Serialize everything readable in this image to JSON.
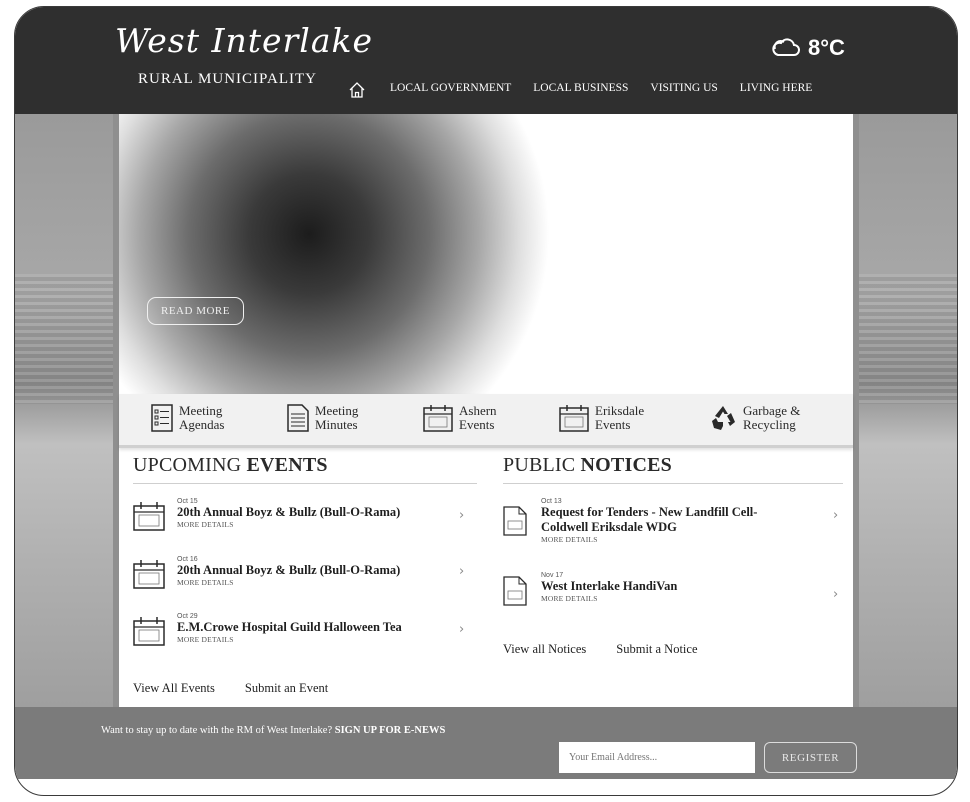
{
  "header": {
    "logo_script": "West Interlake",
    "logo_sub": "RURAL MUNICIPALITY",
    "nav": [
      "LOCAL GOVERNMENT",
      "LOCAL BUSINESS",
      "VISITING US",
      "LIVING HERE"
    ],
    "weather_temp": "8°C"
  },
  "hero": {
    "read_more": "READ MORE"
  },
  "quick_links": [
    {
      "line1": "Meeting",
      "line2": "Agendas",
      "icon": "agenda-list-icon"
    },
    {
      "line1": "Meeting",
      "line2": "Minutes",
      "icon": "document-icon"
    },
    {
      "line1": "Ashern",
      "line2": "Events",
      "icon": "calendar-icon"
    },
    {
      "line1": "Eriksdale",
      "line2": "Events",
      "icon": "calendar-icon"
    },
    {
      "line1": "Garbage &",
      "line2": "Recycling",
      "icon": "recycle-icon"
    }
  ],
  "events": {
    "heading_light": "UPCOMING ",
    "heading_bold": "EVENTS",
    "items": [
      {
        "date": "Oct 15",
        "title": "20th Annual Boyz & Bullz (Bull-O-Rama)",
        "more": "MORE DETAILS"
      },
      {
        "date": "Oct 16",
        "title": "20th Annual Boyz & Bullz (Bull-O-Rama)",
        "more": "MORE DETAILS"
      },
      {
        "date": "Oct 29",
        "title": "E.M.Crowe Hospital Guild Halloween Tea",
        "more": "MORE DETAILS"
      }
    ],
    "view_all": "View All Events",
    "submit": "Submit an Event"
  },
  "notices": {
    "heading_light": "PUBLIC ",
    "heading_bold": "NOTICES",
    "items": [
      {
        "date": "Oct 13",
        "title_line1": "Request for Tenders - New Landfill Cell-",
        "title_line2": "Coldwell Eriksdale WDG",
        "more": "MORE DETAILS"
      },
      {
        "date": "Nov 17",
        "title_line1": "West Interlake HandiVan",
        "title_line2": "",
        "more": "MORE DETAILS"
      }
    ],
    "view_all": "View all Notices",
    "submit": "Submit a Notice"
  },
  "newsletter": {
    "text": "Want to stay up to date with the RM of West Interlake? ",
    "text_bold": "SIGN UP FOR E-NEWS",
    "email_placeholder": "Your Email Address...",
    "register": "REGISTER"
  }
}
